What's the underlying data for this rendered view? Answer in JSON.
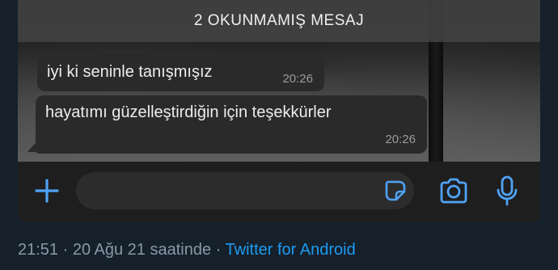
{
  "banner": {
    "text": "2 OKUNMAMIŞ MESAJ"
  },
  "messages": [
    {
      "text": "iyi ki seninle tanışmışız",
      "time": "20:26"
    },
    {
      "text": "hayatımı güzelleştirdiğin için teşekkürler",
      "time": "20:26"
    }
  ],
  "input_bar": {
    "icons": [
      "plus-icon",
      "sticker-icon",
      "camera-icon",
      "mic-icon"
    ],
    "accent": "#4fa3f7"
  },
  "tweet_footer": {
    "time": "21:51",
    "sep1": " · ",
    "date": "20 Ağu 21 saatinde",
    "sep2": " · ",
    "source": "Twitter for Android"
  },
  "colors": {
    "background": "#15202b",
    "source_link": "#1d9bf0",
    "meta_text": "#8899a6"
  }
}
